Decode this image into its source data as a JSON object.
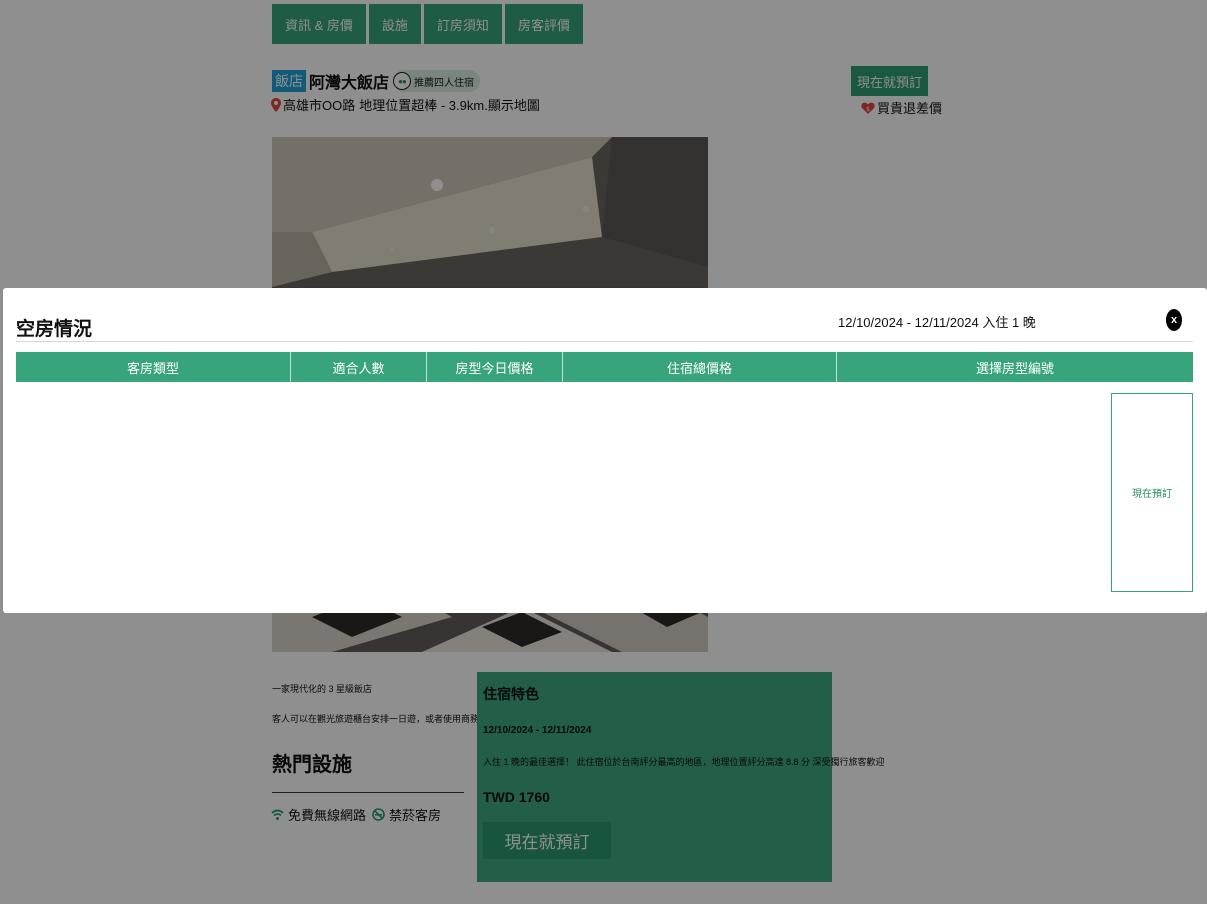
{
  "tabs": [
    {
      "label": "資訊 & 房價"
    },
    {
      "label": "設施"
    },
    {
      "label": "訂房須知"
    },
    {
      "label": "房客評價"
    }
  ],
  "hotel": {
    "type_badge": "飯店",
    "name": "阿灣大飯店",
    "four_person_label": "推薦四人住宿",
    "address": "高雄市OO路",
    "location_note": "地理位置超棒 - 3.9km.",
    "map_link": "顯示地圖",
    "book_now_label": "現在就預訂",
    "price_guarantee": "買貴退差價"
  },
  "photo": {
    "icon": "hotel-lobby-photo"
  },
  "description": {
    "line1": "一家現代化的 3 星級飯店",
    "line2": "客人可以在觀光旅遊櫃台安排一日遊，或者使用商務中心"
  },
  "hot_facilities": {
    "title": "熱門設施",
    "items": [
      {
        "label": "免費無線網路",
        "icon": "wifi-icon"
      },
      {
        "label": "禁菸客房",
        "icon": "no-smoking-icon"
      }
    ]
  },
  "feature_box": {
    "title": "住宿特色",
    "dates": "12/10/2024 - 12/11/2024",
    "description": "入住 1 晚的最佳選擇！ 此住宿位於台南評分最高的地區，地理位置評分高達 8.8 分 深受獨行旅客歡迎",
    "price": "TWD 1760",
    "book_label": "現在就預訂"
  },
  "modal": {
    "title": "空房情況",
    "date_range": "12/10/2024 - 12/11/2024 入住 1 晚",
    "close_label": "x",
    "columns": [
      {
        "label": "客房類型"
      },
      {
        "label": "適合人數"
      },
      {
        "label": "房型今日價格"
      },
      {
        "label": "住宿總價格"
      },
      {
        "label": "選擇房型編號"
      }
    ],
    "row_book_label": "現在預訂"
  },
  "colors": {
    "accent_green": "#38a47c",
    "badge_blue": "#21a3d6",
    "pin_red": "#e0443e"
  }
}
